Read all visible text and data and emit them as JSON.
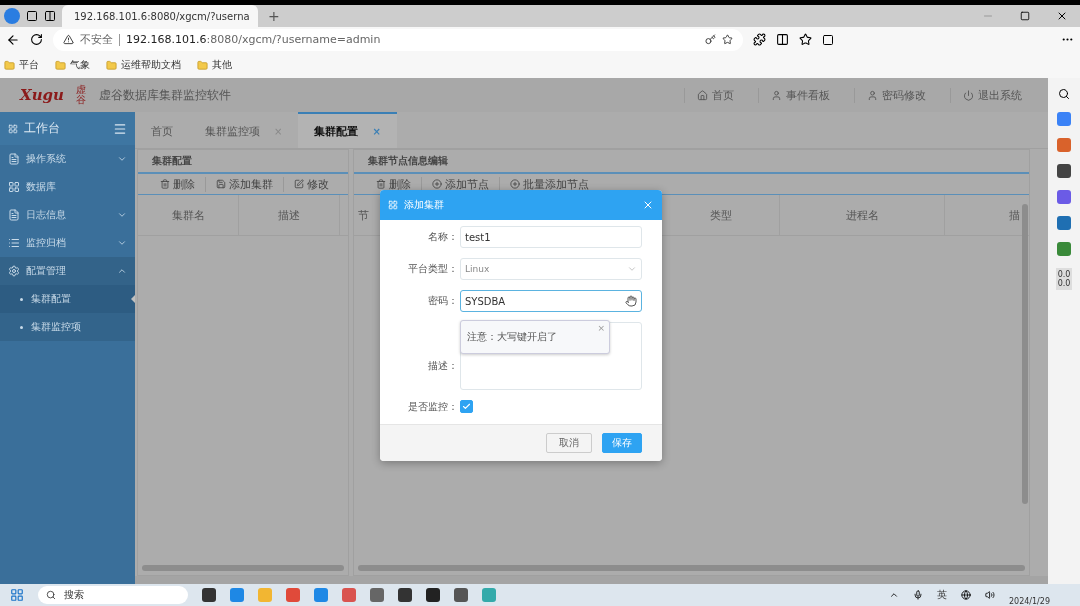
{
  "browser": {
    "tab_title": "192.168.101.6:8080/xgcm/?userna",
    "new_tab": "+",
    "security": "不安全",
    "url_host": "192.168.101.6",
    "url_rest": ":8080/xgcm/?username=admin",
    "bookmarks": [
      "平台",
      "气象",
      "运维帮助文档",
      "其他"
    ]
  },
  "header": {
    "logo_text": "Xugu",
    "logo_mark": "虚谷",
    "title": "虚谷数据库集群监控软件",
    "nav": [
      {
        "label": "首页",
        "kind": "home"
      },
      {
        "label": "事件看板",
        "kind": "user"
      },
      {
        "label": "密码修改",
        "kind": "user"
      },
      {
        "label": "退出系统",
        "kind": "power"
      }
    ]
  },
  "sidebar": {
    "title": "工作台",
    "items": [
      {
        "label": "操作系统",
        "expanded": false,
        "selected": false
      },
      {
        "label": "数据库",
        "selected": false
      },
      {
        "label": "日志信息",
        "expanded": false,
        "selected": false
      },
      {
        "label": "监控归档",
        "expanded": false,
        "selected": false
      },
      {
        "label": "配置管理",
        "expanded": true,
        "selected": true,
        "children": [
          {
            "label": "集群配置",
            "selected": true
          },
          {
            "label": "集群监控项",
            "selected": false
          }
        ]
      }
    ]
  },
  "tabs": [
    {
      "label": "首页",
      "selected": false
    },
    {
      "label": "集群监控项",
      "close": "×",
      "selected": false
    },
    {
      "label": "集群配置",
      "close": "×",
      "selected": true
    }
  ],
  "left_panel": {
    "title": "集群配置",
    "toolbar": [
      "删除",
      "添加集群",
      "修改"
    ],
    "columns": [
      "集群名",
      "描述"
    ]
  },
  "right_panel": {
    "title": "集群节点信息编辑",
    "toolbar": [
      "删除",
      "添加节点",
      "批量添加节点"
    ],
    "columns": [
      "节",
      "类型",
      "进程名",
      "描"
    ]
  },
  "dialog": {
    "title": "添加集群",
    "name_label": "名称：",
    "name_value": "test1",
    "platform_label": "平台类型：",
    "platform_value": "Linux",
    "password_label": "密码：",
    "password_value": "SYSDBA",
    "tooltip": "注意：大写键开启了",
    "tooltip_close": "×",
    "desc_label": "描述：",
    "monitor_label": "是否监控：",
    "monitor_checked": true,
    "buttons": [
      "取消",
      "保存"
    ]
  },
  "edge_sidebar": {
    "readings": [
      "0.0",
      "0.0"
    ]
  },
  "taskbar": {
    "search": "搜索",
    "language": "英",
    "date": "2024/1/29"
  }
}
